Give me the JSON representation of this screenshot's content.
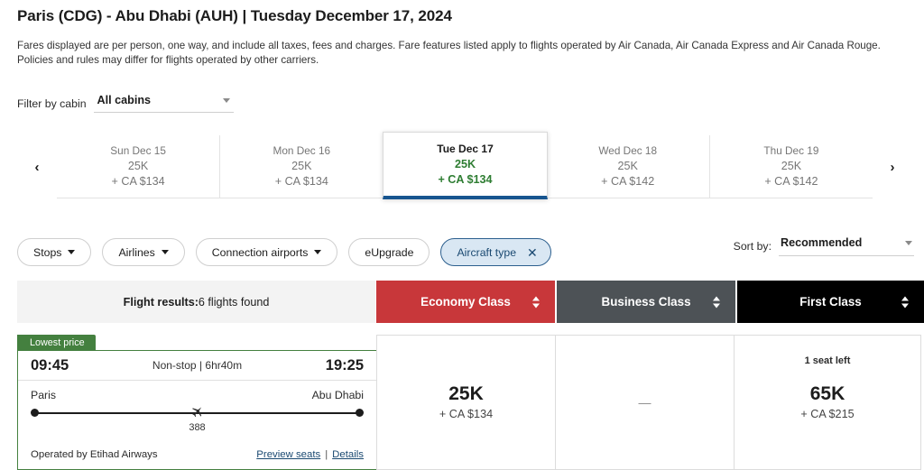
{
  "header": {
    "route_title": "Paris (CDG) - Abu Dhabi (AUH)  |  Tuesday December 17, 2024",
    "disclaimer": "Fares displayed are per person, one way, and include all taxes, fees and charges. Fare features listed apply to flights operated by Air Canada, Air Canada Express and Air Canada Rouge. Policies and rules may differ for flights operated by other carriers."
  },
  "cabin_filter": {
    "label": "Filter by cabin",
    "value": "All cabins"
  },
  "carousel": {
    "prev_icon": "‹",
    "next_icon": "›",
    "dates": [
      {
        "day": "Sun Dec 15",
        "points": "25K",
        "cash": "+ CA $134",
        "selected": false
      },
      {
        "day": "Mon Dec 16",
        "points": "25K",
        "cash": "+ CA $134",
        "selected": false
      },
      {
        "day": "Tue Dec 17",
        "points": "25K",
        "cash": "+ CA $134",
        "selected": true
      },
      {
        "day": "Wed Dec 18",
        "points": "25K",
        "cash": "+ CA $142",
        "selected": false
      },
      {
        "day": "Thu Dec 19",
        "points": "25K",
        "cash": "+ CA $142",
        "selected": false
      }
    ]
  },
  "filters": {
    "chips": [
      {
        "label": "Stops",
        "type": "dropdown",
        "active": false
      },
      {
        "label": "Airlines",
        "type": "dropdown",
        "active": false
      },
      {
        "label": "Connection airports",
        "type": "dropdown",
        "active": false
      },
      {
        "label": "eUpgrade",
        "type": "plain",
        "active": false
      },
      {
        "label": "Aircraft type",
        "type": "removable",
        "active": true,
        "close_icon": "✕"
      }
    ]
  },
  "sort": {
    "label": "Sort by:",
    "value": "Recommended"
  },
  "results_header": {
    "summary_label": "Flight results:",
    "summary_value": " 6 flights found",
    "classes": [
      {
        "name": "Economy Class",
        "color": "#c8373a"
      },
      {
        "name": "Business Class",
        "color": "#4d5256"
      },
      {
        "name": "First Class",
        "color": "#000000"
      }
    ]
  },
  "flights": [
    {
      "badge": "Lowest price",
      "depart_time": "09:45",
      "arrive_time": "19:25",
      "stops_duration": "Non-stop | 6hr40m",
      "origin_city": "Paris",
      "destination_city": "Abu Dhabi",
      "flight_number": "388",
      "operated_by": "Operated by Etihad Airways",
      "preview_seats_link": "Preview seats",
      "link_separator": "|",
      "details_link": "Details",
      "fares": [
        {
          "cabin": "Economy Class",
          "available": true,
          "points": "25K",
          "cash": "+ CA $134",
          "seats_left": ""
        },
        {
          "cabin": "Business Class",
          "available": false,
          "points": "",
          "cash": "",
          "dash": "—",
          "seats_left": ""
        },
        {
          "cabin": "First Class",
          "available": true,
          "points": "65K",
          "cash": "+ CA $215",
          "seats_left": "1 seat left"
        }
      ]
    }
  ]
}
